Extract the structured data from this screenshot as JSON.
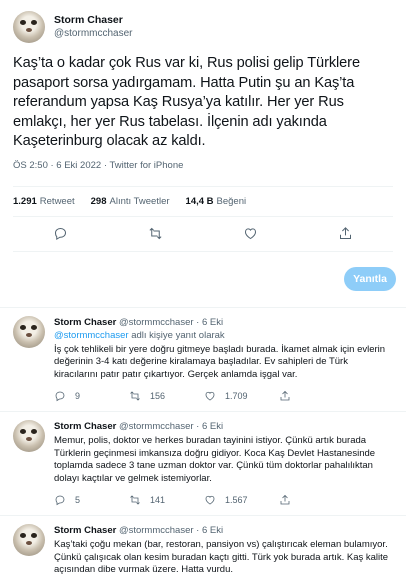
{
  "main": {
    "author_name": "Storm Chaser",
    "author_handle": "@stormmcchaser",
    "text": "Kaş’ta o kadar çok Rus var ki, Rus polisi gelip Türklere pasaport sorsa yadırgamam. Hatta Putin şu an Kaş’ta referandum yapsa Kaş Rusya’ya katılır. Her yer Rus emlakçı, her yer Rus tabelası. İlçenin adı yakında Kaşeterinburg olacak az kaldı.",
    "timestamp": "ÖS 2:50 · 6 Eki 2022 · Twitter for iPhone",
    "stats": [
      {
        "value": "1.291",
        "label": "Retweet"
      },
      {
        "value": "298",
        "label": "Alıntı Tweetler"
      },
      {
        "value": "14,4 B",
        "label": "Beğeni"
      }
    ]
  },
  "reply_button_label": "Yanıtla",
  "replies": [
    {
      "name": "Storm Chaser",
      "meta": "@stormmcchaser · 6 Eki",
      "reply_to_link": "@stormmcchaser",
      "reply_to_text": " adlı kişiye yanıt olarak",
      "text": "İş çok tehlikeli bir yere doğru gitmeye başladı burada. İkamet almak için evlerin değerinin 3-4 katı değerine kiralamaya başladılar. Ev sahipleri de Türk kiracılarını patır patır çıkartıyor. Gerçek anlamda işgal var.",
      "replies": "9",
      "retweets": "156",
      "likes": "1.709"
    },
    {
      "name": "Storm Chaser",
      "meta": "@stormmcchaser · 6 Eki",
      "text": "Memur, polis, doktor ve herkes buradan tayinini istiyor. Çünkü artık burada Türklerin geçinmesi imkansıza doğru gidiyor. Koca Kaş Devlet Hastanesinde toplamda sadece 3 tane uzman doktor var. Çünkü tüm doktorlar pahalılıktan dolayı kaçtılar ve gelmek istemiyorlar.",
      "replies": "5",
      "retweets": "141",
      "likes": "1.567"
    },
    {
      "name": "Storm Chaser",
      "meta": "@stormmcchaser · 6 Eki",
      "text": "Kaş’taki çoğu mekan (bar, restoran, pansiyon vs) çalıştırıcak eleman bulamıyor. Çünkü çalışıcak olan kesim buradan kaçtı gitti. Türk yok burada artık. Kaş kalite açısından dibe vurmak üzere. Hatta vurdu."
    }
  ],
  "icons": {
    "reply": "reply-icon",
    "retweet": "retweet-icon",
    "like": "heart-icon",
    "share": "share-icon"
  }
}
